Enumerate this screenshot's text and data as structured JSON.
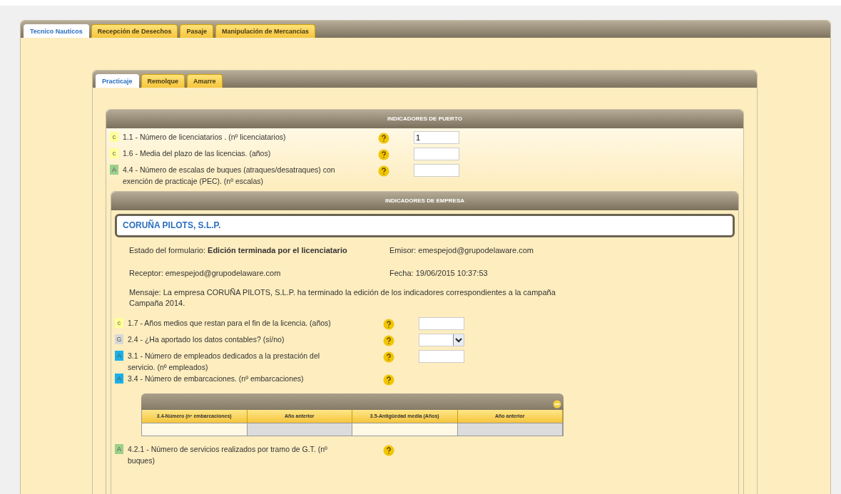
{
  "top_tabs": [
    {
      "label": "Tecnico Nauticos",
      "selected": true
    },
    {
      "label": "Recepción de Desechos",
      "selected": false
    },
    {
      "label": "Pasaje",
      "selected": false
    },
    {
      "label": "Manipulación de Mercancias",
      "selected": false
    }
  ],
  "sub_tabs": [
    {
      "label": "Practicaje",
      "selected": true
    },
    {
      "label": "Remolque",
      "selected": false
    },
    {
      "label": "Amarre",
      "selected": false
    }
  ],
  "port_section": {
    "title": "INDICADORES DE PUERTO",
    "rows": [
      {
        "badge": "c",
        "color": "#ffff99",
        "label": "1.1 - Número de licenciatarios . (nº licenciatarios)",
        "kind": "input",
        "value": "1"
      },
      {
        "badge": "c",
        "color": "#ffff99",
        "label": "1.6 - Media del plazo de las licencias. (años)",
        "kind": "input"
      },
      {
        "badge": "A",
        "color": "#9ccf8a",
        "label": "4.4 - Número de escalas de buques (atraques/desatraques) con exención de practicaje (PEC). (nº escalas)",
        "kind": "input"
      }
    ]
  },
  "company_section": {
    "title": "INDICADORES DE EMPRESA",
    "company": "CORUÑA PILOTS, S.L.P.",
    "status": "Estado del formulario: **Edición terminada por el licenciatario**",
    "emisor": "Emisor: emespejod@grupodelaware.com",
    "receptor": "Receptor: emespejod@grupodelaware.com",
    "fecha": "Fecha: 19/06/2015 10:37:53",
    "mensaje": "Mensaje: La empresa CORUÑA PILOTS, S.L.P. ha terminado la edición de los indicadores correspondientes a la campaña Campaña 2014.",
    "rows": [
      {
        "badge": "c",
        "color": "#ffff99",
        "label": "1.7 - Años medios que restan para el fin de la licencia. (años)",
        "kind": "input"
      },
      {
        "badge": "G",
        "color": "#d8d8d8",
        "label": "2.4 - ¿Ha aportado los datos contables? (sí/no)",
        "kind": "select"
      },
      {
        "badge": "A",
        "color": "#1ab0e8",
        "label": "3.1 - Número de empleados dedicados a la prestación del servicio. (nº empleados)",
        "kind": "input"
      },
      {
        "badge": "A",
        "color": "#1ab0e8",
        "label": "3.4 - Número de embarcaciones. (nº embarcaciones)"
      }
    ],
    "table": {
      "columns": [
        "3.4-Número (nº embarcaciones)",
        "Año anterior",
        "3.5-Antigüedad media (Años)",
        "Año anterior"
      ],
      "cells": [
        {
          "kind": "editable"
        },
        {
          "kind": "readonly"
        },
        {
          "kind": "editable"
        },
        {
          "kind": "readonly"
        }
      ]
    },
    "rows_after": [
      {
        "badge": "A",
        "color": "#9ccf8a",
        "label": "4.2.1 - Número de servicios realizados por tramo de G.T. (nº buques)"
      }
    ]
  }
}
